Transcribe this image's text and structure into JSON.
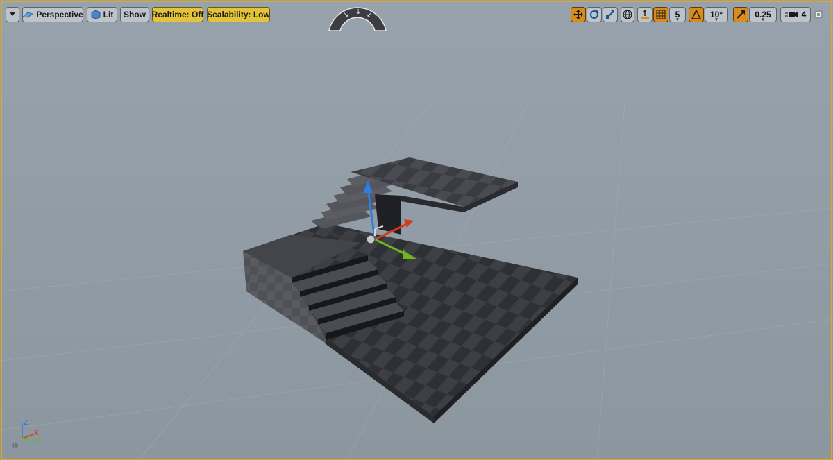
{
  "toolbar": {
    "viewport_menu_icon": "chevron-down-icon",
    "perspective_label": "Perspective",
    "lit_label": "Lit",
    "show_label": "Show",
    "realtime_label": "Realtime: Off",
    "scalability_label": "Scalability: Low",
    "grid_snap_value": "5",
    "rotation_snap_value": "10°",
    "scale_snap_value": "0.25",
    "camera_speed_value": "4"
  },
  "axis_indicator": {
    "z": "Z",
    "x": "X",
    "y": "Y"
  },
  "colors": {
    "viewport_bg": "#95a0aa",
    "viewport_border": "#e0a81a",
    "realtime_button": "#e2c33a",
    "active_tool": "#d98c1c",
    "gizmo_x": "#d43b1c",
    "gizmo_y": "#6fb51f",
    "gizmo_z": "#2f7de0"
  },
  "icons": {
    "perspective": "perspective-cube-icon",
    "lit": "lit-sphere-icon",
    "translate": "translate-tool-icon",
    "rotate": "rotate-tool-icon",
    "scale": "scale-tool-icon",
    "world_local": "globe-icon",
    "surface_snap": "surface-snap-icon",
    "grid_snap": "grid-icon",
    "rotation_snap": "rotation-snap-icon",
    "scale_snap": "scale-snap-icon",
    "camera_speed": "camera-icon",
    "maximize": "maximize-icon",
    "pilot": "pilot-dial-icon"
  }
}
